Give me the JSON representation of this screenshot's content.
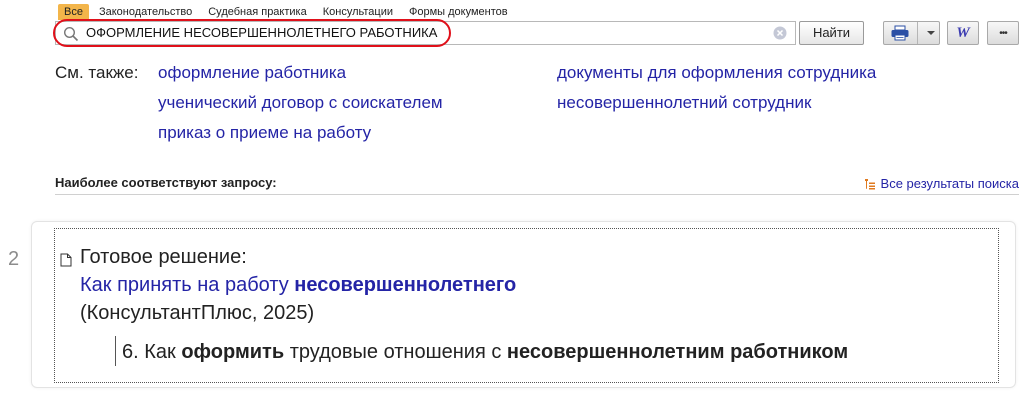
{
  "tabs": [
    {
      "label": "Все",
      "active": true
    },
    {
      "label": "Законодательство",
      "active": false
    },
    {
      "label": "Судебная практика",
      "active": false
    },
    {
      "label": "Консультации",
      "active": false
    },
    {
      "label": "Формы документов",
      "active": false
    }
  ],
  "search": {
    "value": "ОФОРМЛЕНИЕ НЕСОВЕРШЕННОЛЕТНЕГО РАБОТНИКА",
    "find_label": "Найти",
    "search_icon": "search-icon",
    "clear_icon": "clear-icon"
  },
  "toolbar": {
    "print_icon": "printer-icon",
    "dropdown_icon": "chevron-down-icon",
    "word_label": "W",
    "more_label": "•••"
  },
  "see_also": {
    "label": "См. также:",
    "links": [
      "оформление работника",
      "ученический договор с соискателем",
      "приказ о приеме на работу",
      "документы для оформления сотрудника",
      "несовершеннолетний сотрудник"
    ]
  },
  "results_header": {
    "title": "Наиболее соответствуют запросу:",
    "all_results": "Все результаты поиска"
  },
  "result": {
    "number": "2",
    "type": "Готовое решение:",
    "title_prefix": "Как принять на работу",
    "title_bold": "несовершеннолетнего",
    "source": "(КонсультантПлюс, 2025)",
    "snippet": {
      "part1": "6. Как",
      "bold1": "оформить",
      "part2": "трудовые отношения с",
      "bold2": "несовершеннолетним работником"
    }
  },
  "colors": {
    "accent_tab": "#f3b54a",
    "link": "#2424a6",
    "highlight": "#e0101a"
  }
}
